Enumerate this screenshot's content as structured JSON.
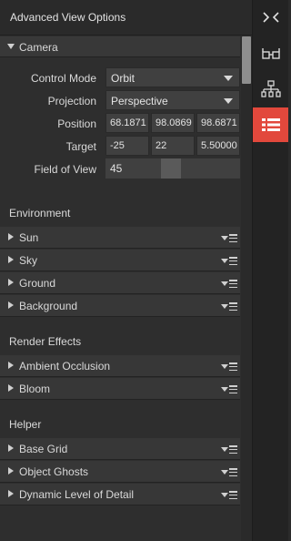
{
  "panel": {
    "title": "Advanced View Options"
  },
  "camera": {
    "section_label": "Camera",
    "control_mode": {
      "label": "Control Mode",
      "value": "Orbit"
    },
    "projection": {
      "label": "Projection",
      "value": "Perspective"
    },
    "position": {
      "label": "Position",
      "x": "68.1871",
      "y": "98.0869",
      "z": "98.6871"
    },
    "target": {
      "label": "Target",
      "x": "-25",
      "y": "22",
      "z": "5.50000"
    },
    "field_of_view": {
      "label": "Field of View",
      "value": "45"
    }
  },
  "groups": {
    "environment": {
      "title": "Environment",
      "items": [
        "Sun",
        "Sky",
        "Ground",
        "Background"
      ]
    },
    "render_effects": {
      "title": "Render Effects",
      "items": [
        "Ambient Occlusion",
        "Bloom"
      ]
    },
    "helper": {
      "title": "Helper",
      "items": [
        "Base Grid",
        "Object Ghosts",
        "Dynamic Level of Detail"
      ]
    }
  },
  "sidebar": {
    "icons": [
      "collapse-icon",
      "glasses-icon",
      "hierarchy-icon",
      "list-icon"
    ],
    "active": "list-icon",
    "accent_color": "#e2483c"
  },
  "scroll": {
    "position_fraction": 0.0
  }
}
